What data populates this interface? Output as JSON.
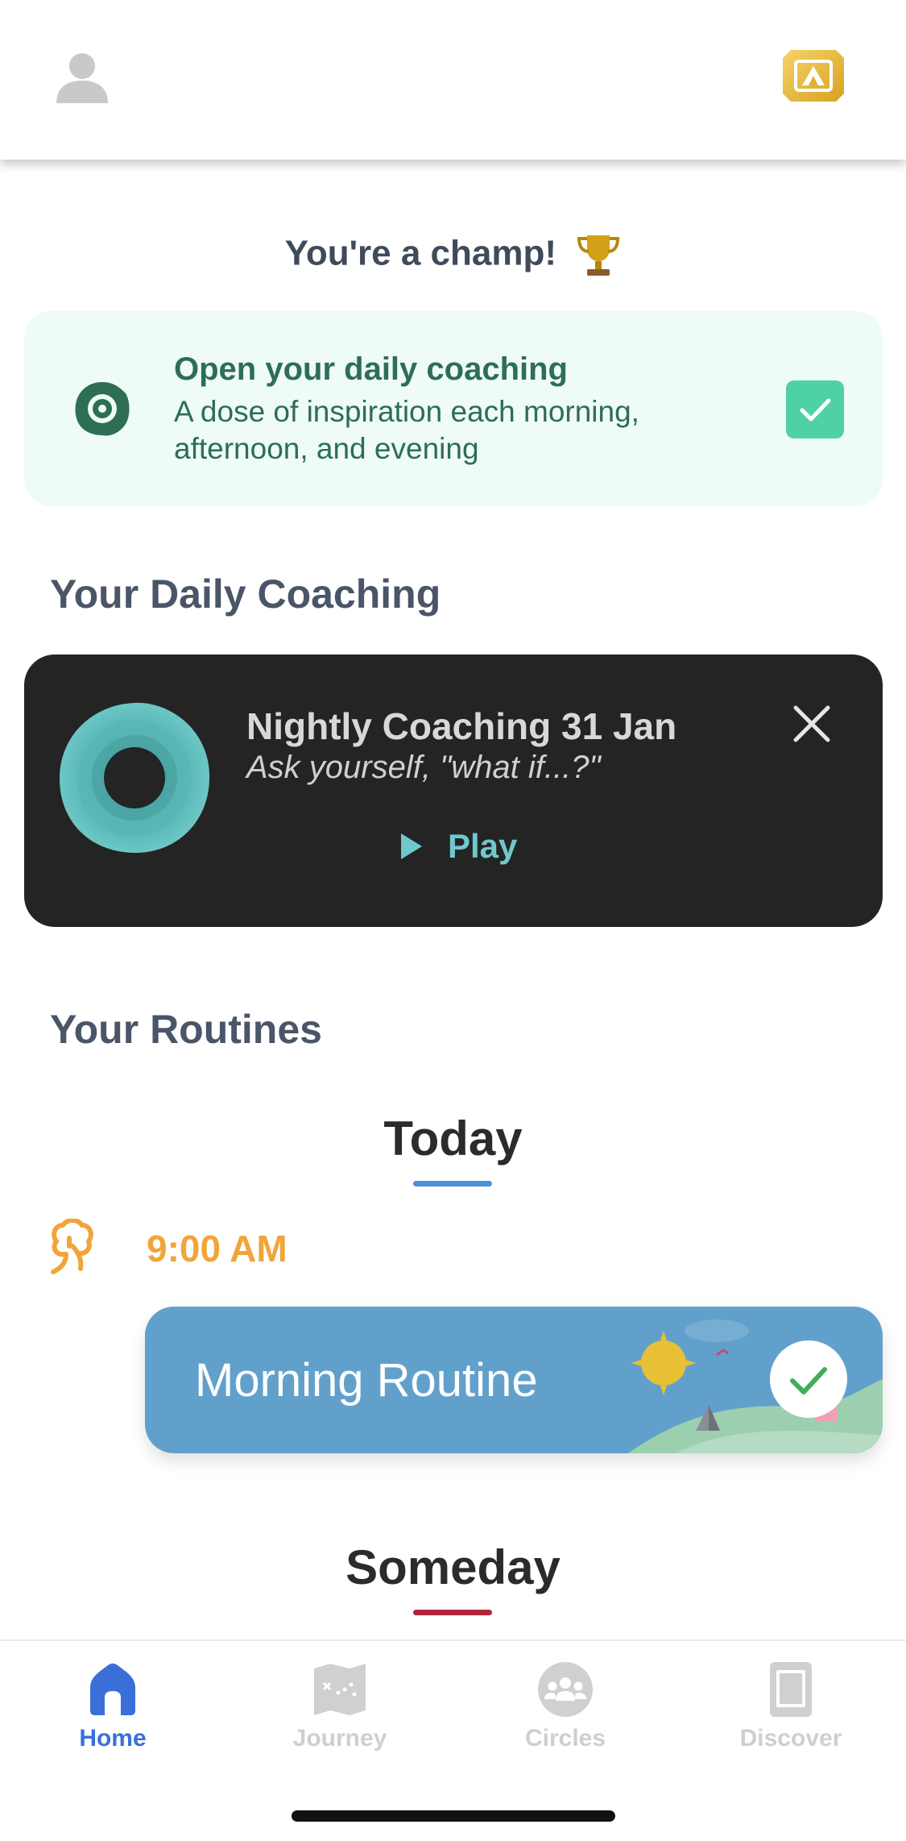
{
  "header": {
    "avatar_icon": "user-icon",
    "badge_icon": "premium-badge-icon"
  },
  "champ": {
    "text": "You're a champ!",
    "icon": "trophy-icon"
  },
  "coaching_prompt": {
    "title": "Open your daily coaching",
    "description": "A dose of inspiration each morning, afternoon, and evening",
    "icon": "coaching-target-icon",
    "checked": true
  },
  "daily_coaching": {
    "section_title": "Your Daily Coaching",
    "card": {
      "title": "Nightly Coaching 31 Jan",
      "subtitle": "Ask yourself, \"what if...?\"",
      "play_label": "Play"
    }
  },
  "routines": {
    "section_title": "Your Routines",
    "today_tab": "Today",
    "today_color": "#4a90e2",
    "time": "9:00 AM",
    "routine_name": "Morning Routine",
    "routine_completed": true,
    "someday_tab": "Someday",
    "someday_color": "#b0243a"
  },
  "bottom_nav": {
    "items": [
      {
        "label": "Home",
        "icon": "home-icon",
        "active": true
      },
      {
        "label": "Journey",
        "icon": "journey-map-icon",
        "active": false
      },
      {
        "label": "Circles",
        "icon": "circles-group-icon",
        "active": false
      },
      {
        "label": "Discover",
        "icon": "discover-book-icon",
        "active": false
      }
    ],
    "active_color": "#3b6fd8",
    "inactive_color": "#cfcfcf"
  }
}
